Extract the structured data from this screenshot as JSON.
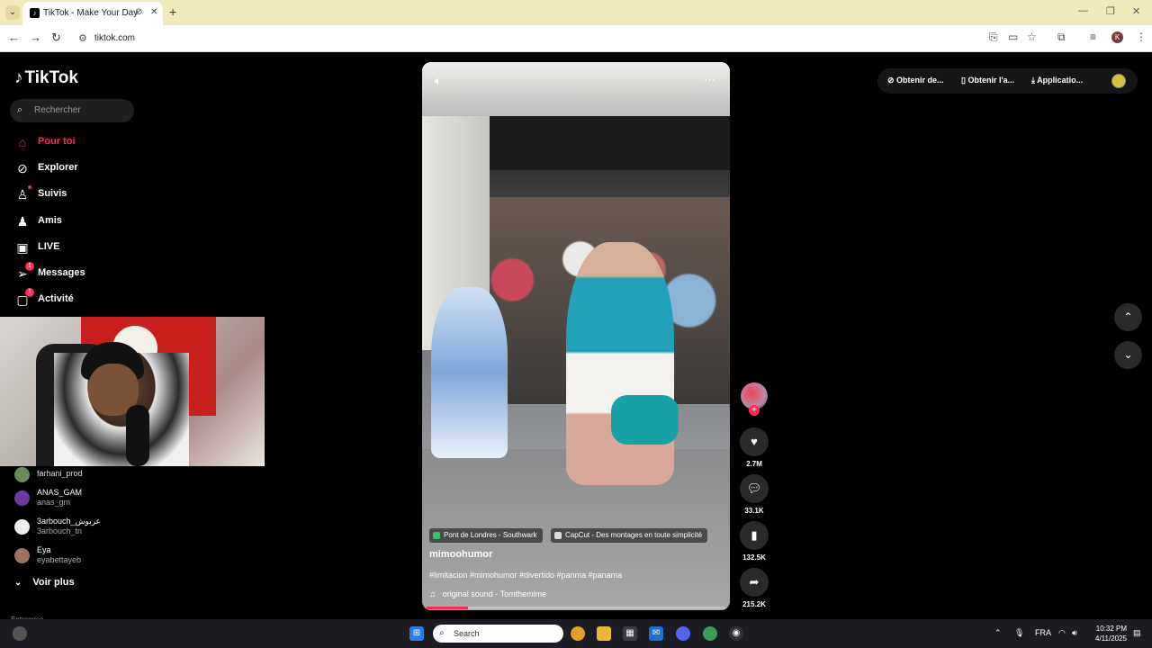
{
  "browser": {
    "tab_title": "TikTok - Make Your Day",
    "url": "tiktok.com"
  },
  "sidebar": {
    "logo": "TikTok",
    "search_placeholder": "Rechercher",
    "nav": [
      {
        "label": "Pour toi",
        "icon": "home-icon",
        "active": true
      },
      {
        "label": "Explorer",
        "icon": "compass-icon"
      },
      {
        "label": "Suivis",
        "icon": "user-follow-icon"
      },
      {
        "label": "Amis",
        "icon": "friends-icon"
      },
      {
        "label": "LIVE",
        "icon": "live-icon"
      },
      {
        "label": "Messages",
        "icon": "send-icon",
        "badge": "1"
      },
      {
        "label": "Activité",
        "icon": "inbox-icon",
        "badge": "1"
      }
    ],
    "following": [
      {
        "name": "farhani_prod",
        "handle": ""
      },
      {
        "name": "ANAS_GAM",
        "handle": "anas_gm"
      },
      {
        "name": "3arbouch_عربوش",
        "handle": "3arbouch_tn"
      },
      {
        "name": "Eya",
        "handle": "eyabettayeb"
      }
    ],
    "see_more": "Voir plus",
    "section_heading": "Entreprise"
  },
  "video": {
    "location_pill": "Pont de Londres - Southwark",
    "capcut_pill": "CapCut - Des montages en toute simplicité",
    "author": "mimoohumor",
    "hashtags": "#limitacion #mimohumor #divertido #panma #panama",
    "sound": "original sound - Tomthemime",
    "progress": 0.14
  },
  "actions": {
    "likes": "2.7M",
    "comments": "33.1K",
    "saves": "132.5K",
    "shares": "215.2K"
  },
  "topbar": {
    "btn1": "Obtenir de...",
    "btn2": "Obtenir l'a...",
    "btn3": "Applicatio..."
  },
  "taskbar": {
    "search": "Search",
    "lang": "FRA",
    "time": "10:32 PM",
    "date": "4/11/2025"
  },
  "colors": {
    "accent": "#fe2c55",
    "tabbar": "#efe9bb"
  }
}
